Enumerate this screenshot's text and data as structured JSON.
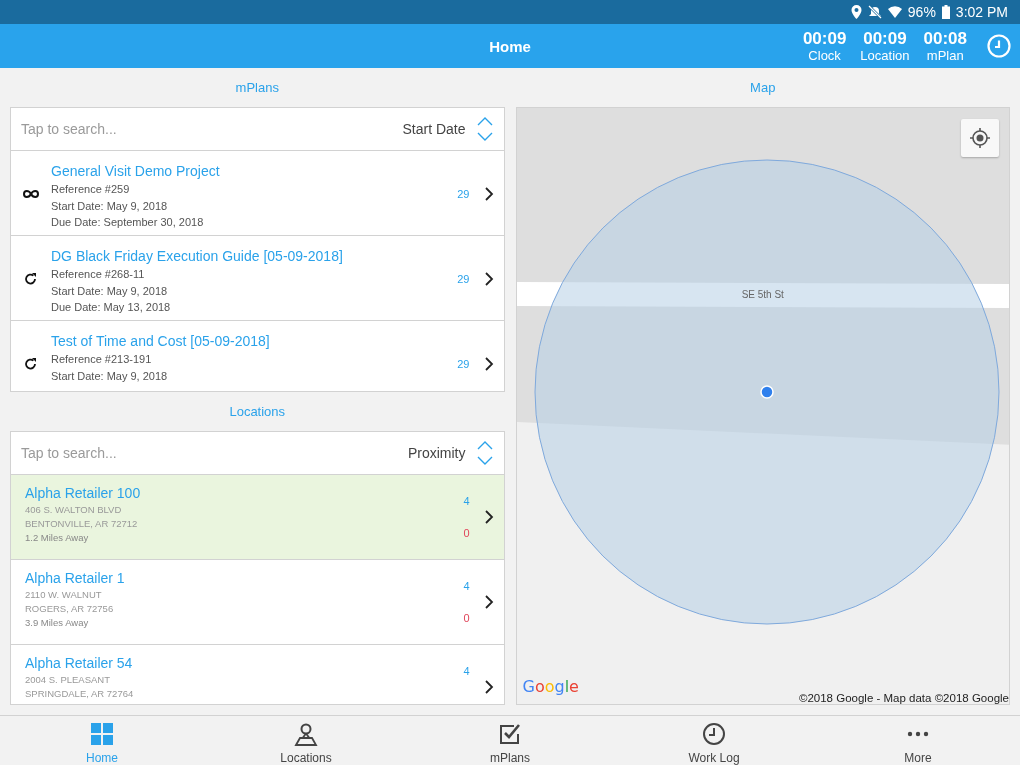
{
  "status_bar": {
    "battery": "96%",
    "time": "3:02 PM"
  },
  "header": {
    "title": "Home",
    "timers": [
      {
        "value": "00:09",
        "label": "Clock"
      },
      {
        "value": "00:09",
        "label": "Location"
      },
      {
        "value": "00:08",
        "label": "mPlan"
      }
    ]
  },
  "mplans": {
    "title": "mPlans",
    "search": {
      "placeholder": "Tap to search..."
    },
    "sort": "Start Date",
    "items": [
      {
        "kind": "ongoing",
        "name": "General Visit Demo Project",
        "lines": [
          "Reference #259",
          "Start Date: May 9, 2018",
          "Due Date: September 30, 2018"
        ],
        "count": "29"
      },
      {
        "kind": "recurring",
        "name": "DG Black Friday Execution Guide [05-09-2018]",
        "lines": [
          "Reference #268-11",
          "Start Date: May 9, 2018",
          "Due Date: May 13, 2018"
        ],
        "count": "29"
      },
      {
        "kind": "recurring",
        "name": "Test of Time and Cost [05-09-2018]",
        "lines": [
          "Reference #213-191",
          "Start Date: May 9, 2018"
        ],
        "count": "29"
      }
    ]
  },
  "locations": {
    "title": "Locations",
    "search": {
      "placeholder": "Tap to search..."
    },
    "sort": "Proximity",
    "items": [
      {
        "name": "Alpha Retailer 100",
        "lines": [
          "406 S. WALTON BLVD",
          "BENTONVILLE, AR 72712"
        ],
        "distance": "1.2 Miles Away",
        "count_done": "4",
        "count_open": "0",
        "selected": true
      },
      {
        "name": "Alpha Retailer 1",
        "lines": [
          "2110 W. WALNUT",
          "ROGERS, AR 72756"
        ],
        "distance": "3.9 Miles Away",
        "count_done": "4",
        "count_open": "0",
        "selected": false
      },
      {
        "name": "Alpha Retailer 54",
        "lines": [
          "2004 S. PLEASANT",
          "SPRINGDALE, AR 72764"
        ],
        "count_done": "4",
        "selected": false
      }
    ]
  },
  "map": {
    "title": "Map",
    "logo": "Google",
    "street": "SE 5th St",
    "attribution": "©2018 Google - Map data ©2018 Google"
  },
  "nav": [
    {
      "kind": "home",
      "label": "Home",
      "selected": true
    },
    {
      "kind": "locations",
      "label": "Locations",
      "selected": false
    },
    {
      "kind": "mplans",
      "label": "mPlans",
      "selected": false
    },
    {
      "kind": "worklog",
      "label": "Work Log",
      "selected": false
    },
    {
      "kind": "more",
      "label": "More",
      "selected": false
    }
  ]
}
